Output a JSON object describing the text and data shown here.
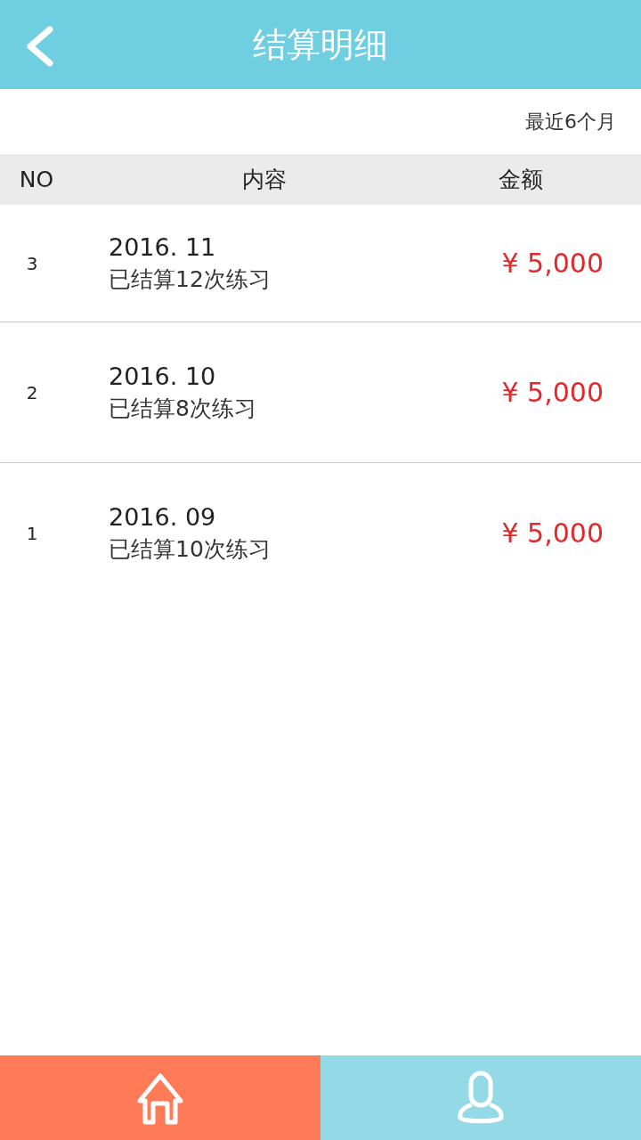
{
  "header": {
    "title": "结算明细"
  },
  "filter": {
    "label": "最近6个月"
  },
  "table": {
    "columns": [
      "NO",
      "内容",
      "金额"
    ],
    "rows": [
      {
        "no": "3",
        "date": "2016. 11",
        "desc": "已结算12次练习",
        "amount": "¥ 5,000"
      },
      {
        "no": "2",
        "date": "2016. 10",
        "desc": "已结算8次练习",
        "amount": "¥ 5,000"
      },
      {
        "no": "1",
        "date": "2016. 09",
        "desc": "已结算10次练习",
        "amount": "¥ 5,000"
      }
    ]
  },
  "tabs": [
    {
      "kind": "home",
      "selected": true
    },
    {
      "kind": "profile",
      "selected": false
    }
  ]
}
